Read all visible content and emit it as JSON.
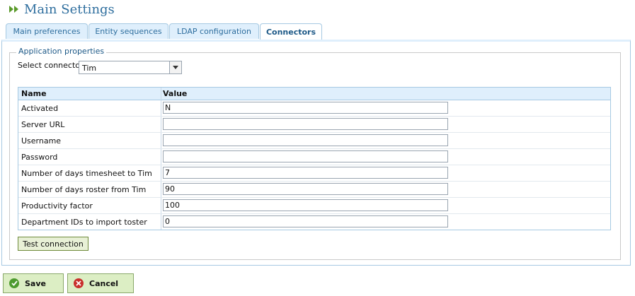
{
  "page": {
    "title": "Main Settings"
  },
  "tabs": [
    {
      "label": "Main preferences"
    },
    {
      "label": "Entity sequences"
    },
    {
      "label": "LDAP configuration"
    },
    {
      "label": "Connectors"
    }
  ],
  "application_properties": {
    "legend": "Application properties",
    "select_label": "Select connector",
    "select_value": "Tim"
  },
  "grid": {
    "headers": {
      "name": "Name",
      "value": "Value"
    },
    "rows": [
      {
        "name": "Activated",
        "value": "N"
      },
      {
        "name": "Server URL",
        "value": ""
      },
      {
        "name": "Username",
        "value": ""
      },
      {
        "name": "Password",
        "value": ""
      },
      {
        "name": "Number of days timesheet to Tim",
        "value": "7"
      },
      {
        "name": "Number of days roster from Tim",
        "value": "90"
      },
      {
        "name": "Productivity factor",
        "value": "100"
      },
      {
        "name": "Department IDs to import toster",
        "value": "0"
      }
    ]
  },
  "buttons": {
    "test_connection": "Test connection",
    "save": "Save",
    "cancel": "Cancel"
  },
  "colors": {
    "accent": "#2e6e9e",
    "tab_bg": "#dfeffc",
    "save_icon": "#4d9a2e",
    "cancel_icon": "#c9302c"
  }
}
